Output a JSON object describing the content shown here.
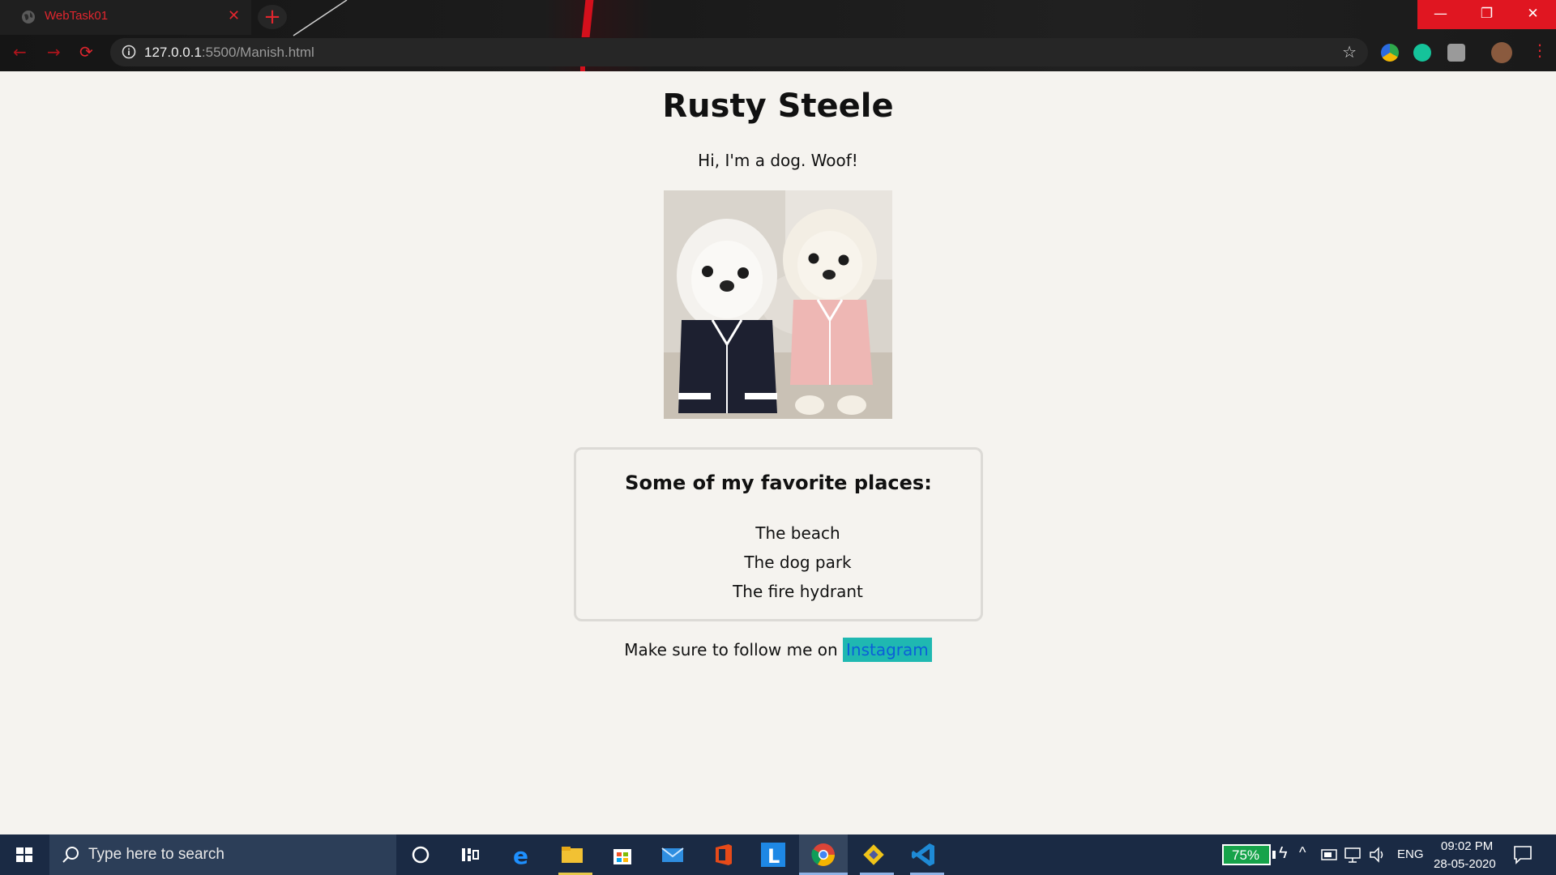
{
  "browser": {
    "tab_title": "WebTask01",
    "tab_close": "✕",
    "new_tab": "+",
    "url_host": "127.0.0.1",
    "url_rest": ":5500/Manish.html",
    "window_controls": [
      "—",
      "❐",
      "✕"
    ]
  },
  "page": {
    "title": "Rusty Steele",
    "intro": "Hi, I'm a dog. Woof!",
    "places_title": "Some of my favorite places:",
    "places": [
      "The beach",
      "The dog park",
      "The fire hydrant"
    ],
    "follow_text": "Make sure to follow me on ",
    "follow_link": "Instagram"
  },
  "taskbar": {
    "search_placeholder": "Type here to search",
    "battery": "75%",
    "language": "ENG",
    "time": "09:02 PM",
    "date": "28-05-2020"
  },
  "colors": {
    "accent_red": "#e1262e",
    "link_highlight": "#1fb8b1",
    "link_text": "#0b5fd8",
    "taskbar_bg": "#1a2a44"
  }
}
